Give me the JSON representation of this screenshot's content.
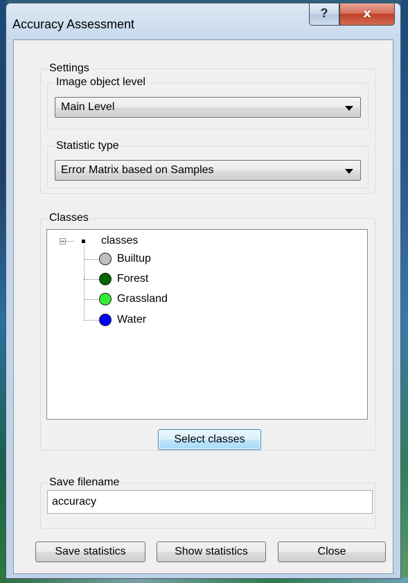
{
  "window": {
    "title": "Accuracy Assessment",
    "help_label": "?",
    "close_label": "x"
  },
  "settings": {
    "group_label": "Settings",
    "level": {
      "label": "Image object level",
      "value": "Main Level"
    },
    "statistic": {
      "label": "Statistic type",
      "value": "Error Matrix based on Samples"
    }
  },
  "classes": {
    "group_label": "Classes",
    "root": "classes",
    "items": [
      {
        "label": "Builtup",
        "color": "#c0c0c0"
      },
      {
        "label": "Forest",
        "color": "#006600"
      },
      {
        "label": "Grassland",
        "color": "#33ee33"
      },
      {
        "label": "Water",
        "color": "#0000ff"
      }
    ],
    "select_button": "Select classes"
  },
  "save": {
    "group_label": "Save filename",
    "value": "accuracy"
  },
  "buttons": {
    "save_statistics": "Save statistics",
    "show_statistics": "Show statistics",
    "close": "Close"
  }
}
